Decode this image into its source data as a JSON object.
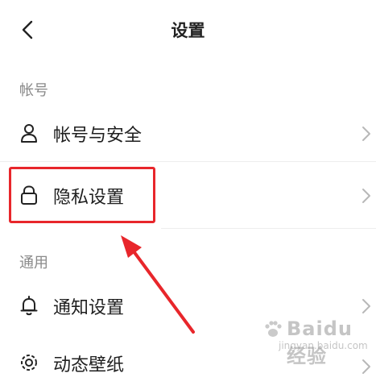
{
  "header": {
    "title": "设置",
    "back_icon": "chevron-left-icon"
  },
  "sections": [
    {
      "label": "帐号"
    },
    {
      "label": "通用"
    }
  ],
  "rows": [
    {
      "label": "帐号与安全",
      "icon": "user-icon"
    },
    {
      "label": "隐私设置",
      "icon": "lock-icon"
    },
    {
      "label": "通知设置",
      "icon": "bell-icon"
    },
    {
      "label": "动态壁纸",
      "icon": "gear-icon"
    }
  ],
  "annotation": {
    "highlight_color": "#e8262b"
  },
  "watermark": {
    "text": "Baidu经验",
    "sub": "jingyan.baidu.com"
  }
}
